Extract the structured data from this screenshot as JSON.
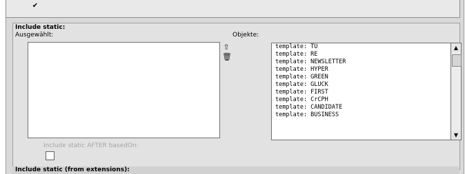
{
  "top": {
    "check_glyph": "✔"
  },
  "include_static": {
    "title": "Include static:",
    "selected_label": "Ausgewählt:",
    "objects_label": "Objekte:",
    "objects": [
      "template: TU",
      "template: RE",
      "template: NEWSLETTER",
      "template: HYPER",
      "template: GREEN",
      "template: GLUCK",
      "template: FIRST",
      "template: CrCPH",
      "template: CANDIDATE",
      "template: BUSINESS"
    ],
    "icons": [
      "move-up-icon",
      "delete-icon"
    ],
    "after_based_on_label": "Include static AFTER basedOn:"
  },
  "include_static_ext": {
    "title": "Include static (from extensions):"
  }
}
